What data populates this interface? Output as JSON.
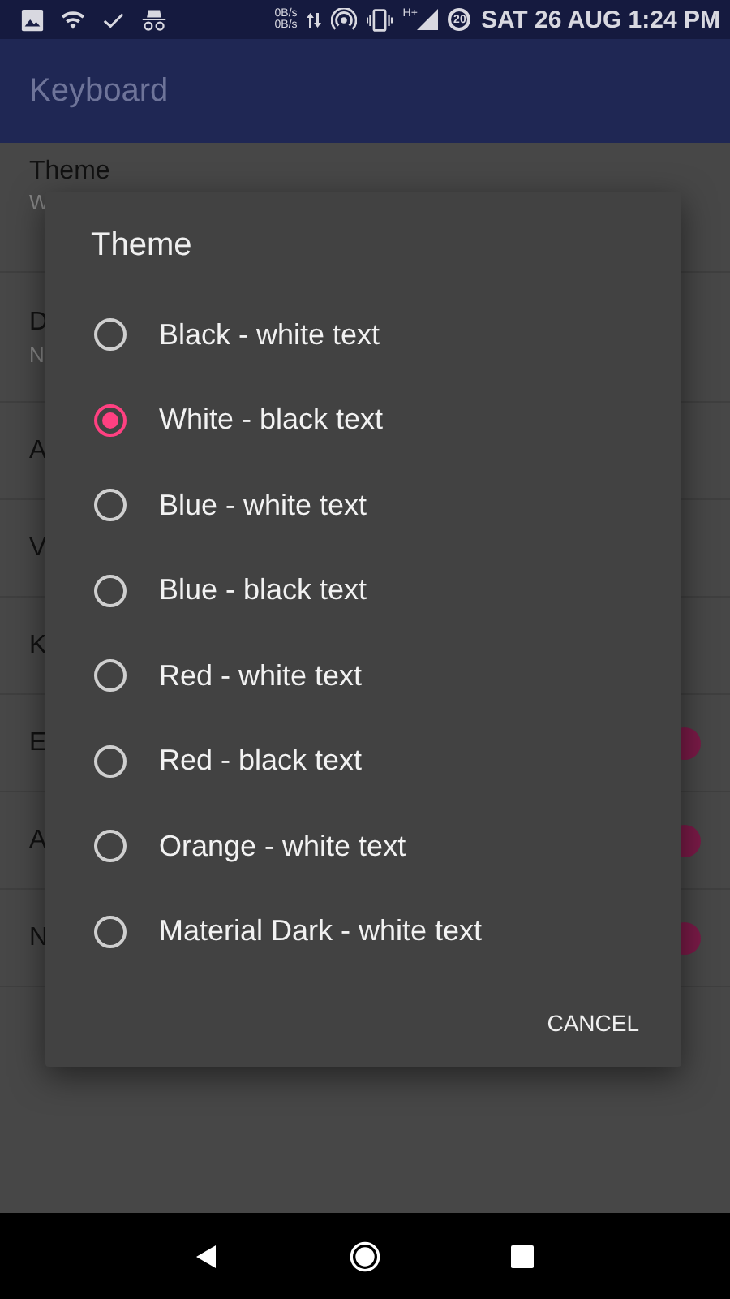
{
  "status_bar": {
    "speed_up": "0B/s",
    "speed_down": "0B/s",
    "network": "H+",
    "battery": "20",
    "clock": "SAT 26 AUG 1:24 PM"
  },
  "app_bar": {
    "title": "Keyboard"
  },
  "settings": [
    {
      "title": "Theme",
      "subtitle": "W",
      "kind": "text"
    },
    {
      "title": "D",
      "subtitle": "N",
      "kind": "text"
    },
    {
      "title": "A",
      "kind": "text"
    },
    {
      "title": "V",
      "kind": "text"
    },
    {
      "title": "K",
      "kind": "text"
    },
    {
      "title": "E",
      "kind": "switch",
      "on": true
    },
    {
      "title": "A",
      "kind": "switch",
      "on": true
    },
    {
      "title": "N",
      "kind": "switch",
      "on": true
    }
  ],
  "dialog": {
    "title": "Theme",
    "options": [
      {
        "label": "Black - white text",
        "selected": false
      },
      {
        "label": "White - black text",
        "selected": true
      },
      {
        "label": "Blue - white text",
        "selected": false
      },
      {
        "label": "Blue - black text",
        "selected": false
      },
      {
        "label": "Red - white text",
        "selected": false
      },
      {
        "label": "Red - black text",
        "selected": false
      },
      {
        "label": "Orange - white text",
        "selected": false
      },
      {
        "label": "Material Dark - white text",
        "selected": false
      }
    ],
    "cancel": "CANCEL"
  }
}
